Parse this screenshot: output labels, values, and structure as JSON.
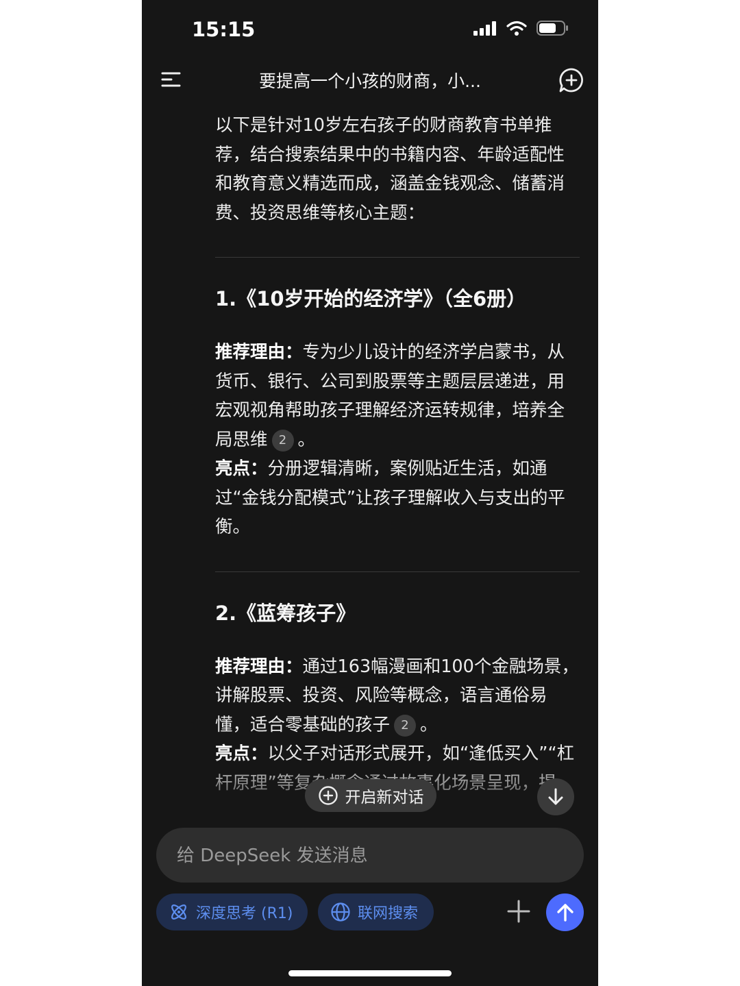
{
  "status": {
    "time": "15:15"
  },
  "header": {
    "title": "要提高一个小孩的财商，小..."
  },
  "intro": "以下是针对10岁左右孩子的财商教育书单推荐，结合搜索结果中的书籍内容、年龄适配性和教育意义精选而成，涵盖金钱观念、储蓄消费、投资思维等核心主题：",
  "books": [
    {
      "heading": "1.《10岁开始的经济学》（全6册）",
      "reason_label": "推荐理由：",
      "reason_text": "专为少儿设计的经济学启蒙书，从货币、银行、公司到股票等主题层层递进，用宏观视角帮助孩子理解经济运转规律，培养全局思维",
      "reason_cite": "2",
      "reason_end": "。",
      "highlight_label": "亮点：",
      "highlight_text": "分册逻辑清晰，案例贴近生活，如通过“金钱分配模式”让孩子理解收入与支出的平衡。"
    },
    {
      "heading": "2.《蓝筹孩子》",
      "reason_label": "推荐理由：",
      "reason_text": "通过163幅漫画和100个金融场景，讲解股票、投资、风险等概念，语言通俗易懂，适合零基础的孩子",
      "reason_cite": "2",
      "reason_end": "。",
      "highlight_label": "亮点：",
      "highlight_text": "以父子对话形式展开，如“逢低买入”“杠杆原理”等复杂概念通过故事化场景呈现，提"
    }
  ],
  "floating": {
    "new_chat": "开启新对话"
  },
  "input": {
    "placeholder": "给 DeepSeek 发送消息"
  },
  "toolbar": {
    "deep_think": "深度思考 (R1)",
    "web_search": "联网搜索"
  },
  "colors": {
    "background": "#161616",
    "accent": "#4d6bfe",
    "chip_text": "#5d8eef",
    "chip_bg": "#1f2d4d"
  },
  "icons": {
    "menu": "menu-icon",
    "new_chat": "chat-plus-icon",
    "scroll_down": "arrow-down-icon",
    "deep_think": "atom-icon",
    "web_search": "globe-icon",
    "attach": "plus-icon",
    "send": "arrow-up-icon"
  }
}
